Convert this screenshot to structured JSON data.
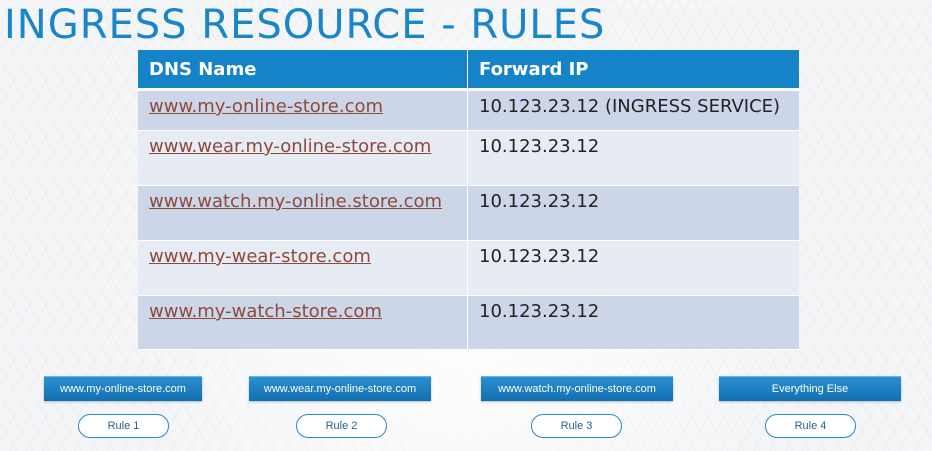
{
  "title": "INGRESS RESOURCE - RULES",
  "table": {
    "headers": {
      "dns": "DNS Name",
      "ip": "Forward IP"
    },
    "rows": [
      {
        "dns": "www.my-online-store.com",
        "ip": "10.123.23.12 (INGRESS SERVICE)"
      },
      {
        "dns": "www.wear.my-online-store.com",
        "ip": "10.123.23.12"
      },
      {
        "dns": "www.watch.my-online.store.com",
        "ip": "10.123.23.12"
      },
      {
        "dns": "www.my-wear-store.com",
        "ip": "10.123.23.12"
      },
      {
        "dns": "www.my-watch-store.com",
        "ip": "10.123.23.12"
      }
    ]
  },
  "hosts": [
    "www.my-online-store.com",
    "www.wear.my-online-store.com",
    "www.watch.my-online-store.com",
    "Everything Else"
  ],
  "rules": [
    "Rule 1",
    "Rule 2",
    "Rule 3",
    "Rule 4"
  ],
  "colors": {
    "accent": "#1483c8",
    "row_dark": "#cdd6e8",
    "row_light": "#e7ecf4",
    "link": "#8b4a3a"
  }
}
